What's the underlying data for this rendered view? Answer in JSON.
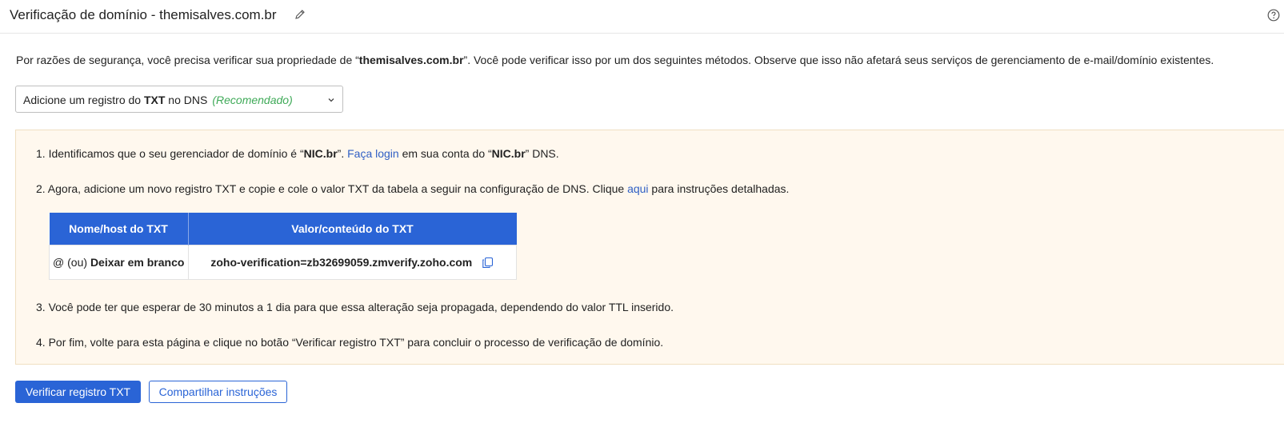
{
  "header": {
    "title": "Verificação de domínio - themisalves.com.br",
    "edit_icon": "pencil-icon",
    "help_icon": "help-circle-icon"
  },
  "intro": {
    "before": "Por razões de segurança, você precisa verificar sua propriedade de “",
    "domain": "themisalves.com.br",
    "after": "”. Você pode verificar isso por um dos seguintes métodos. Observe que isso não afetará seus serviços de gerenciamento de e-mail/domínio existentes."
  },
  "method_select": {
    "prefix": "Adicione um registro do ",
    "bold": "TXT",
    "suffix": " no DNS",
    "recommended": "(Recomendado)",
    "chevron_icon": "chevron-down-icon"
  },
  "steps": {
    "s1": {
      "a": "1. Identificamos que o seu gerenciador de domínio é “",
      "provider": "NIC.br",
      "b": "”. ",
      "login_link": "Faça login",
      "c": " em sua conta do “",
      "provider2": "NIC.br",
      "d": "” DNS."
    },
    "s2": {
      "a": "2. Agora, adicione um novo registro TXT e copie e cole o valor TXT da tabela a seguir na configuração de DNS. Clique ",
      "link": "aqui",
      "b": " para instruções detalhadas."
    },
    "s3": "3. Você pode ter que esperar de 30 minutos a 1 dia para que essa alteração seja propagada, dependendo do valor TTL inserido.",
    "s4": "4. Por fim, volte para esta página e clique no botão “Verificar registro TXT” para concluir o processo de verificação de domínio."
  },
  "table": {
    "headers": [
      "Nome/host do TXT",
      "Valor/conteúdo do TXT"
    ],
    "host_prefix": "@ (ou) ",
    "host_bold": "Deixar em branco",
    "value": "zoho-verification=zb32699059.zmverify.zoho.com",
    "copy_icon": "copy-icon"
  },
  "buttons": {
    "verify": "Verificar registro TXT",
    "share": "Compartilhar instruções"
  },
  "colors": {
    "primary": "#2a64d6",
    "recommended": "#3faa58",
    "panel_bg": "#fff8ee"
  }
}
